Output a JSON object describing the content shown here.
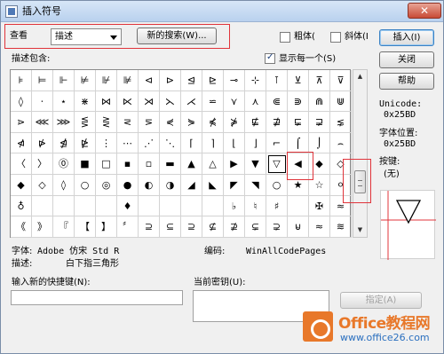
{
  "window": {
    "title": "插入符号",
    "close_glyph": "✕"
  },
  "toolbar": {
    "view_label": "查看",
    "view_select_value": "描述",
    "new_search_label": "新的搜索(W)...",
    "bold_label": "粗体(",
    "italic_label": "斜体(I",
    "insert_label": "插入(I)"
  },
  "side_buttons": {
    "close_label": "关闭",
    "help_label": "帮助"
  },
  "section": {
    "desc_contains_label": "描述包含:",
    "show_each_label": "显示每一个(S)",
    "show_each_checked": true
  },
  "grid": {
    "rows": [
      [
        "⊧",
        "⊨",
        "⊩",
        "⊭",
        "⊮",
        "⊯",
        "⊲",
        "⊳",
        "⊴",
        "⊵",
        "⊸",
        "⊹",
        "⊺",
        "⊻",
        "⊼",
        "⊽"
      ],
      [
        "◊",
        "⋅",
        "⋆",
        "⋇",
        "⋈",
        "⋉",
        "⋊",
        "⋋",
        "⋌",
        "⋍",
        "⋎",
        "⋏",
        "⋐",
        "⋑",
        "⋒",
        "⋓"
      ],
      [
        "⋗",
        "⋘",
        "⋙",
        "⋚",
        "⋛",
        "⋜",
        "⋝",
        "⋞",
        "⋟",
        "⋠",
        "⋡",
        "⋢",
        "⋣",
        "⋤",
        "⋥",
        "⋦"
      ],
      [
        "⋪",
        "⋫",
        "⋬",
        "⋭",
        "⋮",
        "⋯",
        "⋰",
        "⋱",
        "⌈",
        "⌉",
        "⌊",
        "⌋",
        "⌐",
        "⌠",
        "⌡",
        "⌢"
      ],
      [
        "〈",
        "〉",
        "⓪",
        "■",
        "□",
        "▪",
        "▫",
        "▬",
        "▲",
        "△",
        "▶",
        "▼",
        "▽",
        "◀",
        "◆",
        "◇"
      ],
      [
        "◆",
        "◇",
        "◊",
        "○",
        "◎",
        "●",
        "◐",
        "◑",
        "◢",
        "◣",
        "◤",
        "◥",
        "○",
        "★",
        "☆",
        "⚪"
      ],
      [
        "♁",
        "",
        "",
        "",
        "",
        "♦",
        "",
        "",
        "",
        "",
        "♭",
        "♮",
        "♯",
        "",
        "✠",
        "≈"
      ],
      [
        "《",
        "》",
        "『",
        "【",
        "】",
        "〞",
        "⊇",
        "⊆",
        "⊇",
        "⊈",
        "⊉",
        "⊊",
        "⊋",
        "⊌",
        "≈",
        "≋"
      ]
    ],
    "selected_index": 76
  },
  "info": {
    "unicode_label": "Unicode:",
    "unicode_value": "0x25BD",
    "position_label": "字体位置:",
    "position_value": "0x25BD",
    "key_label": "按键:",
    "key_value": "(无)"
  },
  "details": {
    "font_label": "字体:",
    "font_value": "Adobe 仿宋 Std R",
    "encoding_label": "编码:",
    "encoding_value": "WinAllCodePages",
    "desc_label": "描述:",
    "desc_value": "白下指三角形"
  },
  "shortcut": {
    "new_key_label": "输入新的快捷键(N):",
    "current_key_label": "当前密钥(U):",
    "assign_label": "指定(A)"
  },
  "watermark": {
    "brand": "Office教程网",
    "url": "www.office26.com"
  },
  "colors": {
    "highlight": "#e0343b",
    "brand_orange": "#e8782a",
    "brand_blue": "#2a6fbf"
  }
}
